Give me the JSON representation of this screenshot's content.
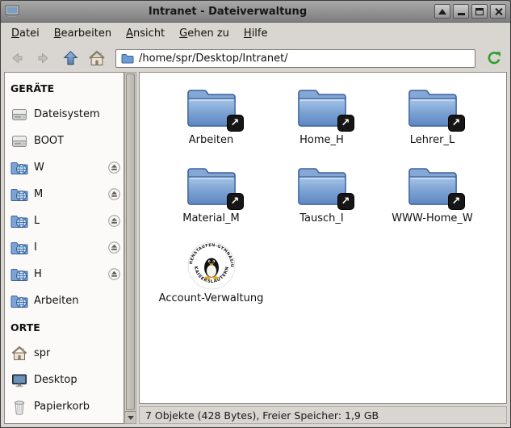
{
  "window": {
    "title": "Intranet - Dateiverwaltung",
    "icon": "file-manager-window-icon",
    "controls": [
      {
        "name": "shade"
      },
      {
        "name": "minimize"
      },
      {
        "name": "maximize"
      },
      {
        "name": "close"
      }
    ]
  },
  "menubar": {
    "items": [
      "Datei",
      "Bearbeiten",
      "Ansicht",
      "Gehen zu",
      "Hilfe"
    ]
  },
  "toolbar": {
    "back": "back-icon",
    "forward": "forward-icon",
    "up": "up-icon",
    "home": "home-icon",
    "reload": "reload-icon",
    "path": "/home/spr/Desktop/Intranet/"
  },
  "sidebar": {
    "sections": [
      {
        "header": "GERÄTE",
        "items": [
          {
            "label": "Dateisystem",
            "icon": "harddrive-icon",
            "eject": false
          },
          {
            "label": "BOOT",
            "icon": "harddrive-icon",
            "eject": false
          },
          {
            "label": "W",
            "icon": "network-folder-icon",
            "eject": true
          },
          {
            "label": "M",
            "icon": "network-folder-icon",
            "eject": true
          },
          {
            "label": "L",
            "icon": "network-folder-icon",
            "eject": true
          },
          {
            "label": "I",
            "icon": "network-folder-icon",
            "eject": true
          },
          {
            "label": "H",
            "icon": "network-folder-icon",
            "eject": true
          },
          {
            "label": "Arbeiten",
            "icon": "network-folder-icon",
            "eject": false
          }
        ]
      },
      {
        "header": "ORTE",
        "items": [
          {
            "label": "spr",
            "icon": "home-icon",
            "eject": false
          },
          {
            "label": "Desktop",
            "icon": "desktop-icon",
            "eject": false
          },
          {
            "label": "Papierkorb",
            "icon": "trash-icon",
            "eject": false
          }
        ]
      }
    ]
  },
  "files": [
    {
      "label": "Arbeiten",
      "type": "folder-link"
    },
    {
      "label": "Home_H",
      "type": "folder-link"
    },
    {
      "label": "Lehrer_L",
      "type": "folder-link"
    },
    {
      "label": "Material_M",
      "type": "folder-link"
    },
    {
      "label": "Tausch_I",
      "type": "folder-link"
    },
    {
      "label": "WWW-Home_W",
      "type": "folder-link"
    },
    {
      "label": "Account-Verwaltung",
      "type": "logo",
      "logo_text_top": "HOHENSTAUFEN-GYMNASIUM",
      "logo_text_bottom": "KAISERSLAUTERN"
    }
  ],
  "statusbar": {
    "text": "7 Objekte (428 Bytes), Freier Speicher: 1,9 GB"
  },
  "colors": {
    "folder_blue": "#6f9bd2",
    "titlebar_gray": "#8f8f8f",
    "reload_green": "#2f9e2f",
    "emblem_black": "#161616",
    "background": "#d9d5d0",
    "mainview_white": "#ffffff"
  }
}
